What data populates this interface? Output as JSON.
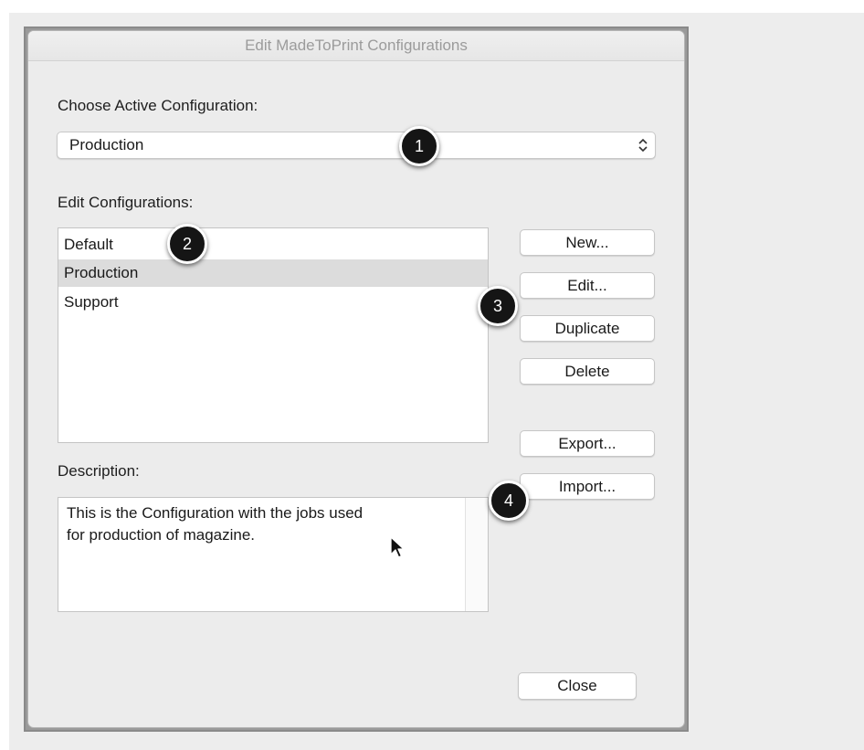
{
  "window": {
    "title": "Edit MadeToPrint Configurations"
  },
  "active_configuration": {
    "label": "Choose Active Configuration:",
    "selected": "Production"
  },
  "edit_configurations": {
    "label": "Edit Configurations:",
    "items": [
      {
        "label": "Default",
        "selected": false
      },
      {
        "label": "Production",
        "selected": true
      },
      {
        "label": "Support",
        "selected": false
      }
    ]
  },
  "buttons": {
    "new": "New...",
    "edit": "Edit...",
    "duplicate": "Duplicate",
    "delete": "Delete",
    "export": "Export...",
    "import": "Import...",
    "close": "Close"
  },
  "description": {
    "label": "Description:",
    "line1": "This is the Configuration with the jobs used",
    "line2": "for production of magazine."
  },
  "callouts": [
    "1",
    "2",
    "3",
    "4"
  ],
  "colors": {
    "selection": "#dcdcdc",
    "callout": "#151515"
  }
}
